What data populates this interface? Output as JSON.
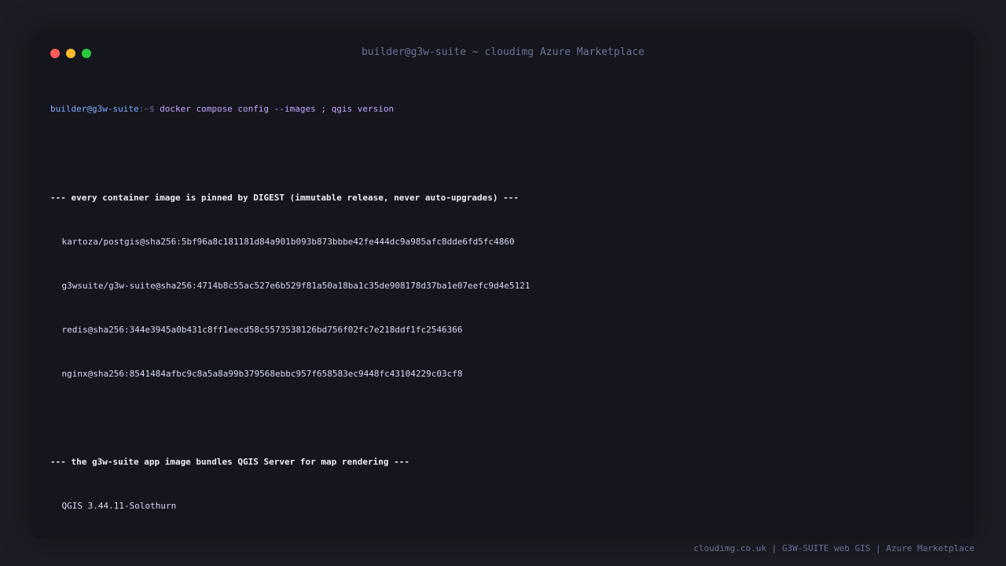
{
  "window": {
    "title": "builder@g3w-suite ~ cloudimg Azure Marketplace",
    "controls": [
      {
        "name": "close",
        "color": "#ff5f57"
      },
      {
        "name": "minimize",
        "color": "#febc2e"
      },
      {
        "name": "maximize",
        "color": "#28c840"
      }
    ]
  },
  "terminal": {
    "prompt": {
      "user_host": "builder@g3w-suite",
      "path_symbol": ":~$ ",
      "command": "docker compose config --images ; qgis version"
    },
    "section1": {
      "header": "--- every container image is pinned by DIGEST (immutable release, never auto-upgrades) ---",
      "images": [
        "kartoza/postgis@sha256:5bf96a8c181181d84a901b093b873bbbe42fe444dc9a985afc8dde6fd5fc4860",
        "g3wsuite/g3w-suite@sha256:4714b8c55ac527e6b529f81a50a18ba1c35de908178d37ba1e07eefc9d4e5121",
        "redis@sha256:344e3945a0b431c8ff1eecd58c5573538126bd756f02fc7e218ddf1fc2546366",
        "nginx@sha256:8541484afbc9c8a5a8a99b379568ebbc957f658583ec9448fc43104229c03cf8"
      ]
    },
    "section2": {
      "header": "--- the g3w-suite app image bundles QGIS Server for map rendering ---",
      "version": "QGIS 3.44.11-Solothurn"
    }
  },
  "footer": {
    "text": "cloudimg.co.uk | G3W-SUITE web GIS | Azure Marketplace"
  },
  "colors": {
    "background": "#1c1c25",
    "terminal_bg": "#15151d",
    "prompt_user": "#82aaff",
    "command": "#c3a6ff",
    "text": "#d6dcf0",
    "muted": "#6a7395"
  }
}
